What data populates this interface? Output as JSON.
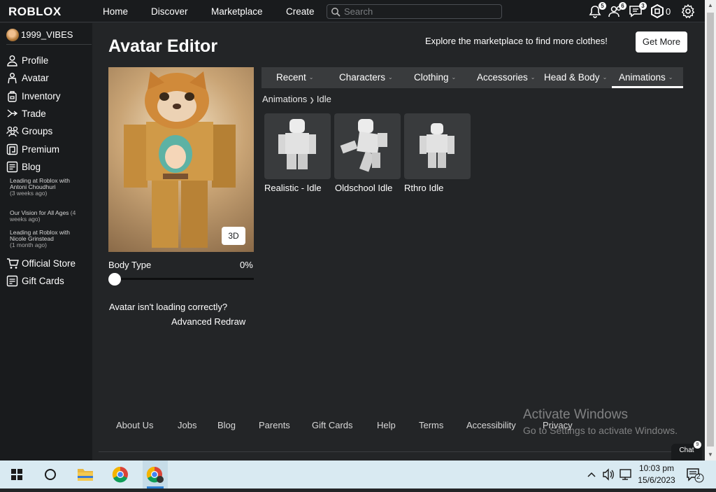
{
  "app": {
    "logo": "ROBLOX",
    "nav": [
      "Home",
      "Discover",
      "Marketplace",
      "Create"
    ],
    "search_placeholder": "Search",
    "notifications_count": "5",
    "friends_count": "6",
    "messages_count": "3",
    "robux": "0"
  },
  "sidebar": {
    "username": "1999_VIBES",
    "items": [
      "Profile",
      "Avatar",
      "Inventory",
      "Trade",
      "Groups",
      "Premium",
      "Blog"
    ],
    "blog_posts": [
      {
        "title": "Leading at Roblox with Antoni Choudhuri",
        "age": "(3 weeks ago)"
      },
      {
        "title": "Our Vision for All Ages",
        "age": "(4 weeks ago)"
      },
      {
        "title": "Leading at Roblox with Nicole Grinstead",
        "age": "(1 month ago)"
      }
    ],
    "bottom_items": [
      "Official Store",
      "Gift Cards"
    ]
  },
  "main": {
    "title": "Avatar Editor",
    "promo": "Explore the marketplace to find more clothes!",
    "get_more": "Get More",
    "btn_3d": "3D",
    "body_type_label": "Body Type",
    "body_type_value": "0%",
    "loading_question": "Avatar isn't loading correctly?",
    "advanced_redraw": "Advanced Redraw",
    "tabs": [
      "Recent",
      "Characters",
      "Clothing",
      "Accessories",
      "Head & Body",
      "Animations"
    ],
    "active_tab": "Animations",
    "breadcrumb": [
      "Animations",
      "Idle"
    ],
    "items": [
      "Realistic - Idle",
      "Oldschool Idle",
      "Rthro Idle"
    ]
  },
  "footer": {
    "links": [
      "About Us",
      "Jobs",
      "Blog",
      "Parents",
      "Gift Cards",
      "Help",
      "Terms",
      "Accessibility",
      "Privacy"
    ]
  },
  "watermark": {
    "line1": "Activate Windows",
    "line2": "Go to Settings to activate Windows."
  },
  "chat": {
    "label": "Chat",
    "count": "9"
  },
  "taskbar": {
    "time": "10:03 pm",
    "date": "15/6/2023",
    "notifications": "2"
  }
}
